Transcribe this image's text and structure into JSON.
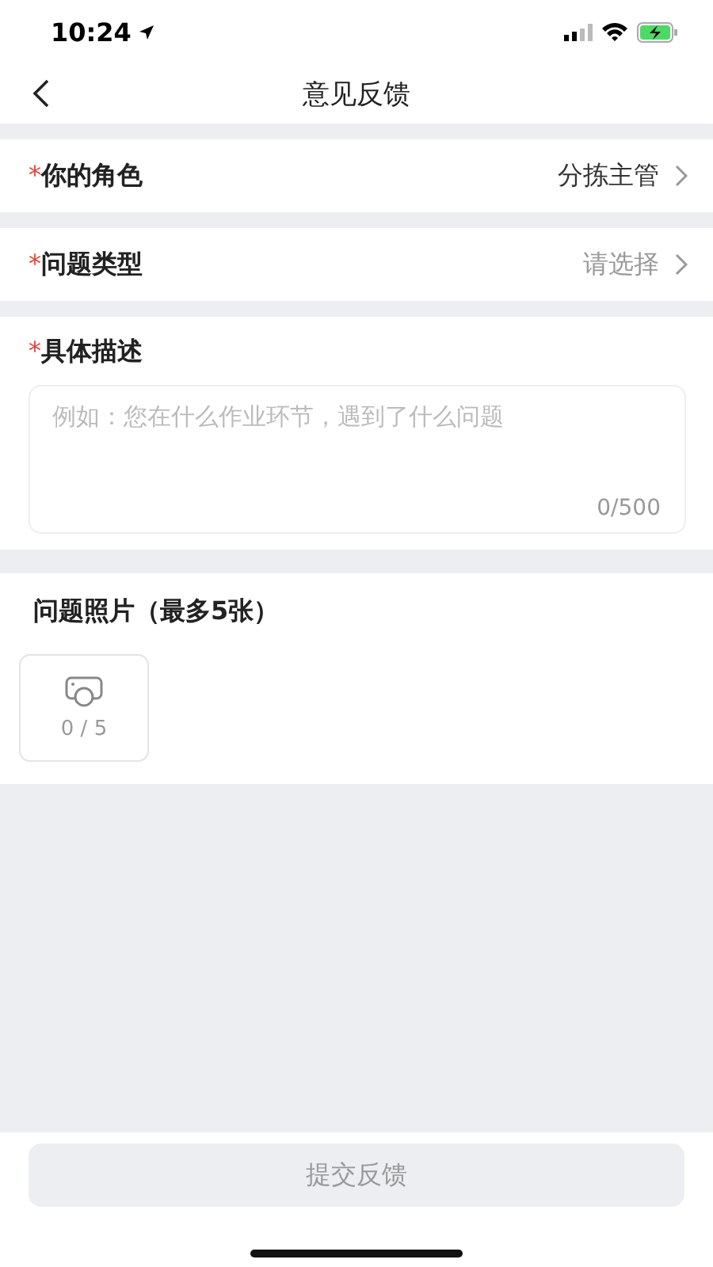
{
  "status_bar": {
    "time": "10:24"
  },
  "nav": {
    "title": "意见反馈"
  },
  "rows": [
    {
      "required_mark": "*",
      "label": "你的角色",
      "value": "分拣主管"
    },
    {
      "required_mark": "*",
      "label": "问题类型",
      "placeholder": "请选择"
    }
  ],
  "description": {
    "required_mark": "*",
    "label": "具体描述",
    "placeholder": "例如：您在什么作业环节，遇到了什么问题",
    "counter": "0/500"
  },
  "photos": {
    "label": "问题照片（最多5张）",
    "counter": "0 / 5"
  },
  "submit": {
    "label": "提交反馈",
    "disabled": true
  }
}
